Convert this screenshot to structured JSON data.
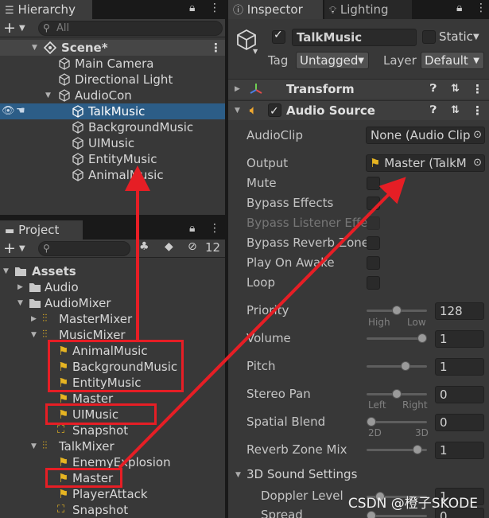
{
  "hierarchy": {
    "tab_label": "Hierarchy",
    "search_placeholder": "All",
    "scene": "Scene*",
    "items": [
      {
        "label": "Main Camera"
      },
      {
        "label": "Directional Light"
      },
      {
        "label": "AudioCon"
      },
      {
        "label": "TalkMusic"
      },
      {
        "label": "BackgroundMusic"
      },
      {
        "label": "UIMusic"
      },
      {
        "label": "EntityMusic"
      },
      {
        "label": "AnimalMusic"
      }
    ]
  },
  "project": {
    "tab_label": "Project",
    "hidden_count": "12",
    "items": [
      {
        "label": "Assets"
      },
      {
        "label": "Audio"
      },
      {
        "label": "AudioMixer"
      },
      {
        "label": "MasterMixer"
      },
      {
        "label": "MusicMixer"
      },
      {
        "label": "AnimalMusic"
      },
      {
        "label": "BackgroundMusic"
      },
      {
        "label": "EntityMusic"
      },
      {
        "label": "Master"
      },
      {
        "label": "UIMusic"
      },
      {
        "label": "Snapshot"
      },
      {
        "label": "TalkMixer"
      },
      {
        "label": "EnemyExplosion"
      },
      {
        "label": "Master"
      },
      {
        "label": "PlayerAttack"
      },
      {
        "label": "Snapshot"
      }
    ]
  },
  "inspector": {
    "tab_label": "Inspector",
    "lighting_tab_label": "Lighting",
    "object_name": "TalkMusic",
    "static_label": "Static",
    "tag_label": "Tag",
    "tag_value": "Untagged",
    "layer_label": "Layer",
    "layer_value": "Default",
    "transform_label": "Transform",
    "audio_source_label": "Audio Source",
    "audioclip_label": "AudioClip",
    "audioclip_value": "None (Audio Clip",
    "output_label": "Output",
    "output_value": "Master (TalkM",
    "mute_label": "Mute",
    "bypass_effects_label": "Bypass Effects",
    "bypass_listener_label": "Bypass Listener Effe",
    "bypass_reverb_label": "Bypass Reverb Zone",
    "play_on_awake_label": "Play On Awake",
    "loop_label": "Loop",
    "priority_label": "Priority",
    "priority_value": "128",
    "priority_fraction": 0.5,
    "priority_high": "High",
    "priority_low": "Low",
    "volume_label": "Volume",
    "volume_value": "1",
    "volume_fraction": 1.0,
    "pitch_label": "Pitch",
    "pitch_value": "1",
    "pitch_fraction": 0.67,
    "stereo_pan_label": "Stereo Pan",
    "stereo_pan_value": "0",
    "stereo_pan_fraction": 0.5,
    "stereo_left": "Left",
    "stereo_right": "Right",
    "spatial_blend_label": "Spatial Blend",
    "spatial_blend_value": "0",
    "spatial_blend_fraction": 0.0,
    "spatial_2d": "2D",
    "spatial_3d": "3D",
    "reverb_mix_label": "Reverb Zone Mix",
    "reverb_mix_value": "1",
    "reverb_mix_fraction": 0.9,
    "sound3d_label": "3D Sound Settings",
    "doppler_label": "Doppler Level",
    "doppler_value": "1",
    "spread_label": "Spread",
    "spread_value": "0"
  },
  "watermark": "CSDN @橙子SKODE",
  "colors": {
    "selection": "#2c5d87",
    "annotation": "#e61e25",
    "mixer_icon": "#e6b422"
  }
}
